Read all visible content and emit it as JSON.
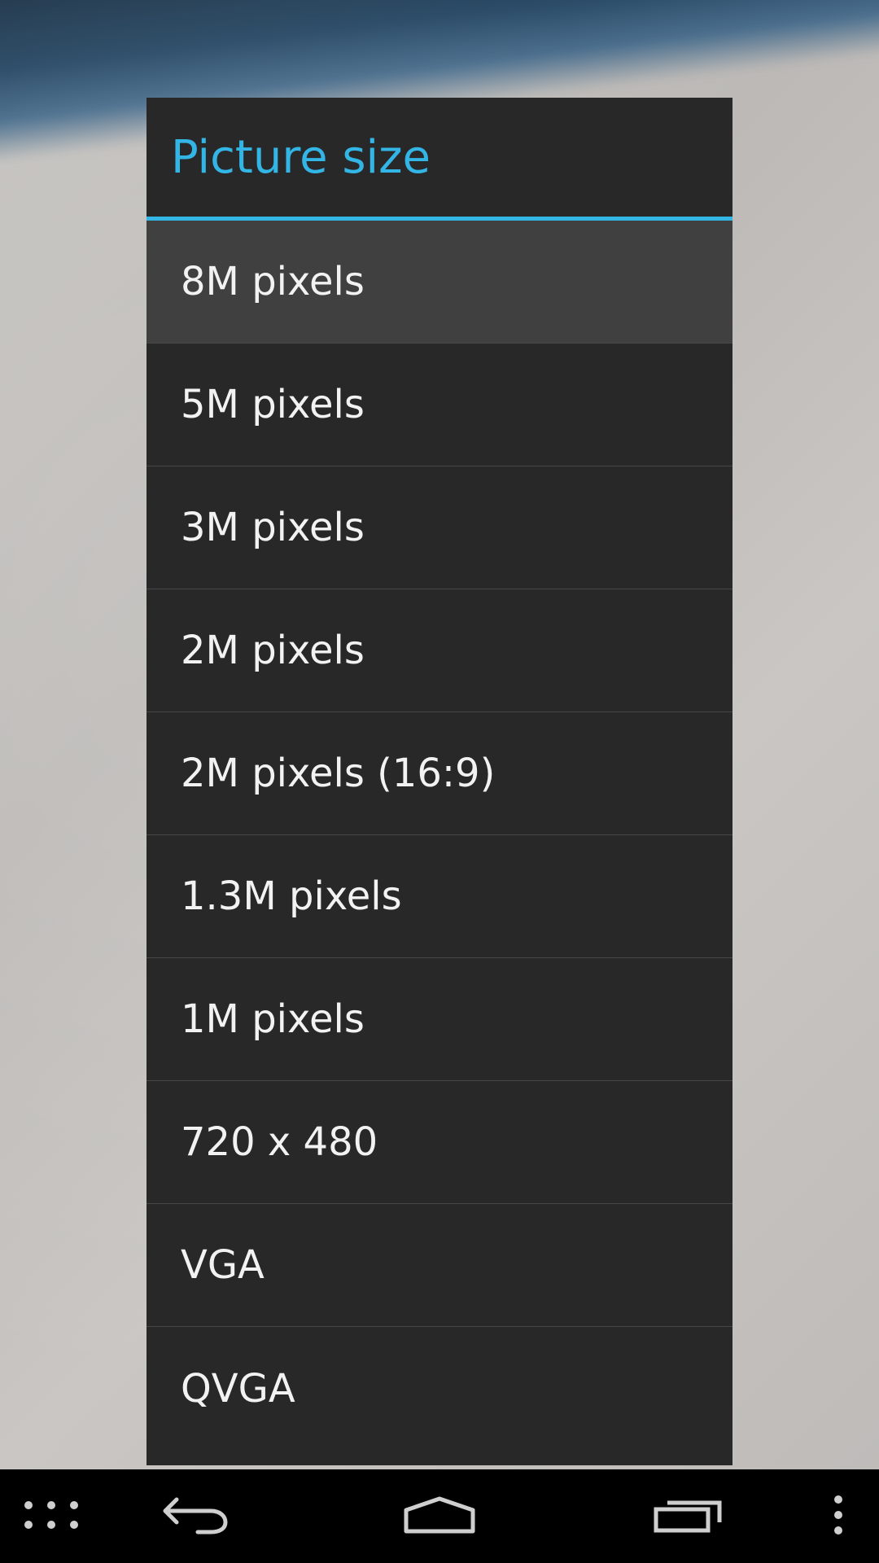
{
  "dialog": {
    "title": "Picture size",
    "options": [
      {
        "label": "8M pixels",
        "selected": true
      },
      {
        "label": "5M pixels",
        "selected": false
      },
      {
        "label": "3M pixels",
        "selected": false
      },
      {
        "label": "2M pixels",
        "selected": false
      },
      {
        "label": "2M pixels (16:9)",
        "selected": false
      },
      {
        "label": "1.3M pixels",
        "selected": false
      },
      {
        "label": "1M pixels",
        "selected": false
      },
      {
        "label": "720 x 480",
        "selected": false
      },
      {
        "label": "VGA",
        "selected": false
      },
      {
        "label": "QVGA",
        "selected": false
      }
    ]
  },
  "navbar": {
    "buttons": [
      "apps-icon",
      "back-icon",
      "home-icon",
      "recent-apps-icon",
      "overflow-menu-icon"
    ]
  },
  "colors": {
    "accent": "#33b5e5",
    "dialog_bg": "#282828",
    "selected_bg": "#404040",
    "text": "#f2f2f2",
    "navbar_bg": "#000000"
  }
}
